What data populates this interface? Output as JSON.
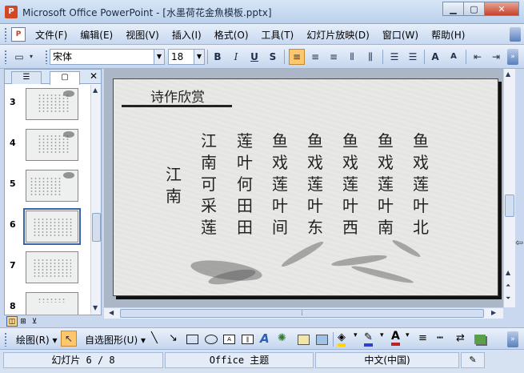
{
  "window": {
    "title": "Microsoft Office PowerPoint - [水墨荷花金魚模板.pptx]",
    "app_icon": "powerpoint-icon",
    "buttons": [
      "minimize",
      "maximize",
      "close"
    ]
  },
  "menubar": {
    "items": [
      "文件(F)",
      "编辑(E)",
      "视图(V)",
      "插入(I)",
      "格式(O)",
      "工具(T)",
      "幻灯片放映(D)",
      "窗口(W)",
      "帮助(H)"
    ]
  },
  "format_toolbar": {
    "font_name": "宋体",
    "font_size": "18",
    "bold": "B",
    "italic": "I",
    "underline": "U",
    "shadow": "S",
    "increase_font": "A",
    "decrease_font": "A"
  },
  "slide_pane": {
    "thumbnails": [
      {
        "number": "3"
      },
      {
        "number": "4"
      },
      {
        "number": "5"
      },
      {
        "number": "6",
        "selected": true
      },
      {
        "number": "7"
      },
      {
        "number": "8"
      }
    ]
  },
  "slide": {
    "heading": "诗作欣赏",
    "poem_title": "江南",
    "poem_columns": [
      "江南可采莲",
      "莲叶何田田",
      "鱼戏莲叶间",
      "鱼戏莲叶东",
      "鱼戏莲叶西",
      "鱼戏莲叶南",
      "鱼戏莲叶北"
    ]
  },
  "drawing_toolbar": {
    "draw_label": "绘图(R)",
    "autoshape_label": "自选图形(U)"
  },
  "statusbar": {
    "slide_info": "幻灯片 6 / 8",
    "theme": "Office 主题",
    "language": "中文(中国)"
  }
}
